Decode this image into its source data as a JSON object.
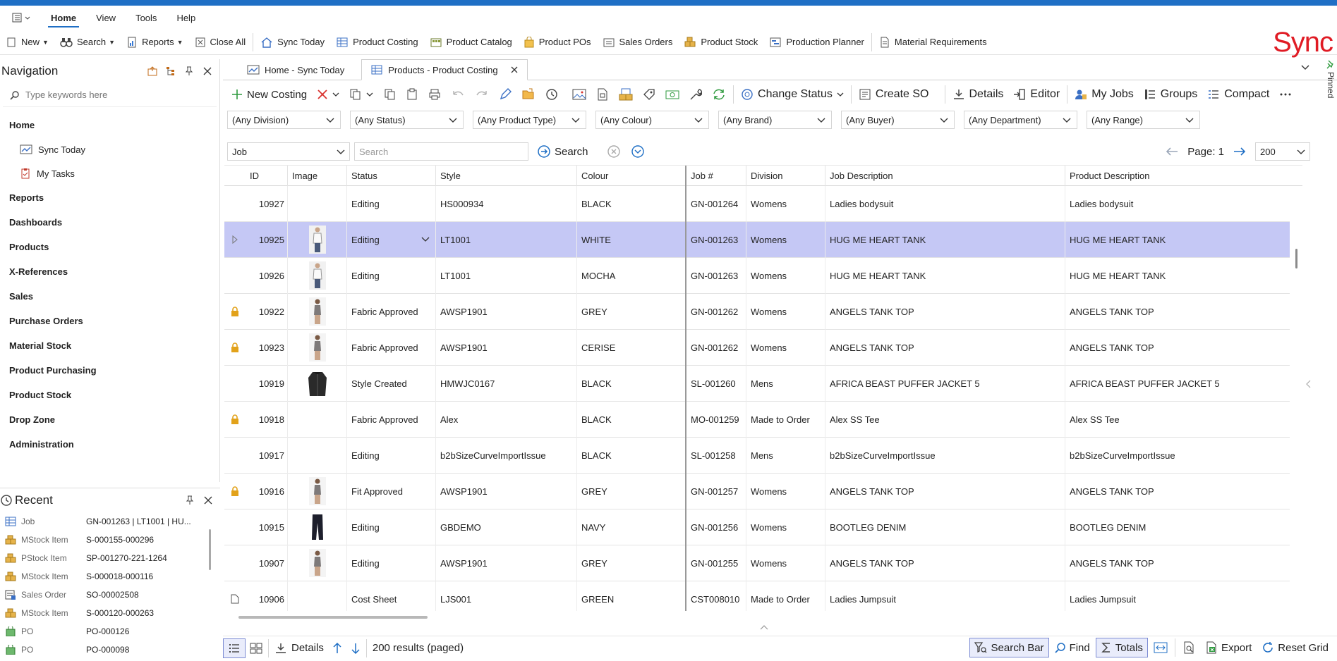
{
  "menu": {
    "items": [
      "Home",
      "View",
      "Tools",
      "Help"
    ]
  },
  "toolbar": {
    "new": "New",
    "search": "Search",
    "reports": "Reports",
    "close_all": "Close All",
    "sync_today": "Sync Today",
    "product_costing": "Product Costing",
    "product_catalog": "Product Catalog",
    "product_pos": "Product POs",
    "sales_orders": "Sales Orders",
    "product_stock": "Product Stock",
    "production_planner": "Production Planner",
    "material_requirements": "Material Requirements"
  },
  "brand": {
    "logo_text": "Sync",
    "color": "#e01b24"
  },
  "navigation": {
    "title": "Navigation",
    "search_placeholder": "Type keywords here",
    "home": "Home",
    "home_items": [
      "Sync Today",
      "My Tasks"
    ],
    "sections": [
      "Reports",
      "Dashboards",
      "Products",
      "X-References",
      "Sales",
      "Purchase Orders",
      "Material Stock",
      "Product Purchasing",
      "Product Stock",
      "Drop Zone",
      "Administration"
    ]
  },
  "recent": {
    "title": "Recent",
    "items": [
      {
        "type": "Job",
        "value": "GN-001263 | LT1001 | HU...",
        "icon": "job-icon"
      },
      {
        "type": "MStock Item",
        "value": "S-000155-000296",
        "icon": "stock-icon"
      },
      {
        "type": "PStock Item",
        "value": "SP-001270-221-1264",
        "icon": "stock-icon"
      },
      {
        "type": "MStock Item",
        "value": "S-000018-000116",
        "icon": "stock-icon"
      },
      {
        "type": "Sales Order",
        "value": "SO-00002508",
        "icon": "sales-order-icon"
      },
      {
        "type": "MStock Item",
        "value": "S-000120-000263",
        "icon": "stock-icon"
      },
      {
        "type": "PO",
        "value": "PO-000126",
        "icon": "po-icon"
      },
      {
        "type": "PO",
        "value": "PO-000098",
        "icon": "po-icon"
      }
    ]
  },
  "tabs": [
    {
      "label": "Home - Sync Today",
      "active": false
    },
    {
      "label": "Products - Product Costing",
      "active": true
    }
  ],
  "pinned_label": "Pinned",
  "grid_toolbar": {
    "new_costing": "New Costing",
    "change_status": "Change Status",
    "create_so": "Create SO",
    "details": "Details",
    "editor": "Editor",
    "my_jobs": "My Jobs",
    "groups": "Groups",
    "compact": "Compact"
  },
  "filters": [
    "(Any Division)",
    "(Any Status)",
    "(Any Product Type)",
    "(Any Colour)",
    "(Any Brand)",
    "(Any Buyer)",
    "(Any Department)",
    "(Any Range)"
  ],
  "search": {
    "field": "Job",
    "placeholder": "Search",
    "button": "Search"
  },
  "pager": {
    "page_label": "Page: 1",
    "page_size": "200"
  },
  "columns": [
    "ID",
    "Image",
    "Status",
    "Style",
    "Colour",
    "Job #",
    "Division",
    "Job Description",
    "Product Description"
  ],
  "rows": [
    {
      "id": "10927",
      "image": "none",
      "status": "Editing",
      "style": "HS000934",
      "colour": "BLACK",
      "job": "GN-001264",
      "division": "Womens",
      "job_desc": "Ladies bodysuit",
      "prod_desc": "Ladies bodysuit",
      "marker": "none",
      "selected": false
    },
    {
      "id": "10925",
      "image": "top-white",
      "status": "Editing",
      "style": "LT1001",
      "colour": "WHITE",
      "job": "GN-001263",
      "division": "Womens",
      "job_desc": "HUG ME HEART TANK",
      "prod_desc": "HUG ME HEART TANK",
      "marker": "expand",
      "selected": true
    },
    {
      "id": "10926",
      "image": "top-white",
      "status": "Editing",
      "style": "LT1001",
      "colour": "MOCHA",
      "job": "GN-001263",
      "division": "Womens",
      "job_desc": "HUG ME HEART TANK",
      "prod_desc": "HUG ME HEART TANK",
      "marker": "none",
      "selected": false
    },
    {
      "id": "10922",
      "image": "tank",
      "status": "Fabric Approved",
      "style": "AWSP1901",
      "colour": "GREY",
      "job": "GN-001262",
      "division": "Womens",
      "job_desc": "ANGELS TANK TOP",
      "prod_desc": "ANGELS TANK TOP",
      "marker": "lock",
      "selected": false
    },
    {
      "id": "10923",
      "image": "tank",
      "status": "Fabric Approved",
      "style": "AWSP1901",
      "colour": "CERISE",
      "job": "GN-001262",
      "division": "Womens",
      "job_desc": "ANGELS TANK TOP",
      "prod_desc": "ANGELS TANK TOP",
      "marker": "lock",
      "selected": false
    },
    {
      "id": "10919",
      "image": "jacket",
      "status": "Style Created",
      "style": "HMWJC0167",
      "colour": "BLACK",
      "job": "SL-001260",
      "division": "Mens",
      "job_desc": "AFRICA BEAST PUFFER JACKET 5",
      "prod_desc": "AFRICA BEAST PUFFER JACKET 5",
      "marker": "none",
      "selected": false
    },
    {
      "id": "10918",
      "image": "none",
      "status": "Fabric Approved",
      "style": "Alex",
      "colour": "BLACK",
      "job": "MO-001259",
      "division": "Made to Order",
      "job_desc": "Alex SS Tee",
      "prod_desc": "Alex SS Tee",
      "marker": "lock",
      "selected": false
    },
    {
      "id": "10917",
      "image": "none",
      "status": "Editing",
      "style": "b2bSizeCurveImportIssue",
      "colour": "BLACK",
      "job": "SL-001258",
      "division": "Mens",
      "job_desc": "b2bSizeCurveImportIssue",
      "prod_desc": "b2bSizeCurveImportIssue",
      "marker": "none",
      "selected": false
    },
    {
      "id": "10916",
      "image": "tank",
      "status": "Fit Approved",
      "style": "AWSP1901",
      "colour": "GREY",
      "job": "GN-001257",
      "division": "Womens",
      "job_desc": "ANGELS TANK TOP",
      "prod_desc": "ANGELS TANK TOP",
      "marker": "lock",
      "selected": false
    },
    {
      "id": "10915",
      "image": "jeans",
      "status": "Editing",
      "style": "GBDEMO",
      "colour": "NAVY",
      "job": "GN-001256",
      "division": "Womens",
      "job_desc": "BOOTLEG DENIM",
      "prod_desc": "BOOTLEG DENIM",
      "marker": "none",
      "selected": false
    },
    {
      "id": "10907",
      "image": "tank",
      "status": "Editing",
      "style": "AWSP1901",
      "colour": "GREY",
      "job": "GN-001255",
      "division": "Womens",
      "job_desc": "ANGELS TANK TOP",
      "prod_desc": "ANGELS TANK TOP",
      "marker": "none",
      "selected": false
    },
    {
      "id": "10906",
      "image": "none",
      "status": "Cost Sheet",
      "style": "LJS001",
      "colour": "GREEN",
      "job": "CST008010",
      "division": "Made to Order",
      "job_desc": "Ladies Jumpsuit",
      "prod_desc": "Ladies Jumpsuit",
      "marker": "doc",
      "selected": false
    }
  ],
  "statusbar": {
    "details": "Details",
    "results": "200 results (paged)",
    "search_bar": "Search Bar",
    "find": "Find",
    "totals": "Totals",
    "export": "Export",
    "reset_grid": "Reset Grid"
  },
  "colors": {
    "accent": "#1f6fc5",
    "selected_row": "#c5c8f5",
    "brand_red": "#e01b24"
  }
}
